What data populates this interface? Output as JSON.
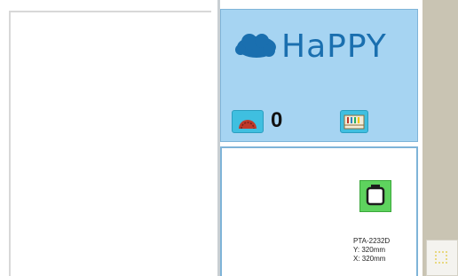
{
  "brand": {
    "name": "HаPPY",
    "icon": "cloud-logo-icon"
  },
  "status": {
    "stitch_counter_value": "0",
    "counter_icon": "speed-dome-icon",
    "stitch_icon": "spool-rack-icon"
  },
  "hoop": {
    "icon": "embroidery-frame-icon",
    "model": "PTA-2232D",
    "y_size": "Y: 320mm",
    "x_size": "X: 320mm"
  },
  "colors": {
    "panel_blue": "#a6d4f2",
    "brand_blue": "#1a6faf",
    "hoop_green": "#5ed35e",
    "icon_cyan": "#3fbfe0"
  }
}
